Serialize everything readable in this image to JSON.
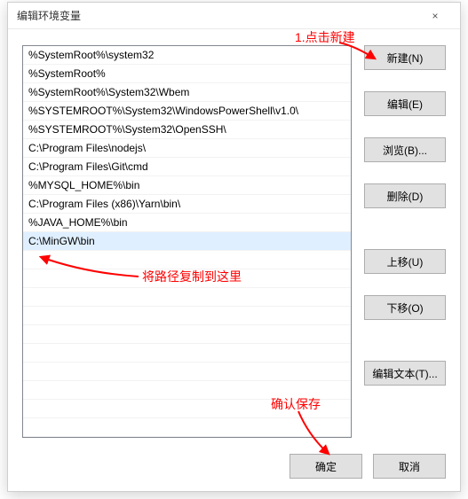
{
  "window": {
    "title": "编辑环境变量",
    "close_icon": "×"
  },
  "path_entries": [
    "%SystemRoot%\\system32",
    "%SystemRoot%",
    "%SystemRoot%\\System32\\Wbem",
    "%SYSTEMROOT%\\System32\\WindowsPowerShell\\v1.0\\",
    "%SYSTEMROOT%\\System32\\OpenSSH\\",
    "C:\\Program Files\\nodejs\\",
    "C:\\Program Files\\Git\\cmd",
    "%MYSQL_HOME%\\bin",
    "C:\\Program Files (x86)\\Yarn\\bin\\",
    "%JAVA_HOME%\\bin",
    "C:\\MinGW\\bin"
  ],
  "selected_index": 10,
  "buttons": {
    "new_": "新建(N)",
    "edit": "编辑(E)",
    "browse": "浏览(B)...",
    "delete_": "删除(D)",
    "move_up": "上移(U)",
    "move_down": "下移(O)",
    "edit_text": "编辑文本(T)...",
    "ok": "确定",
    "cancel": "取消"
  },
  "annotations": {
    "step1": "1.点击新建",
    "step2": "将路径复制到这里",
    "step3": "确认保存"
  },
  "colors": {
    "annotation": "#ff0000",
    "selection": "#dfefff",
    "button_bg": "#e1e1e1",
    "button_border": "#adadad"
  }
}
